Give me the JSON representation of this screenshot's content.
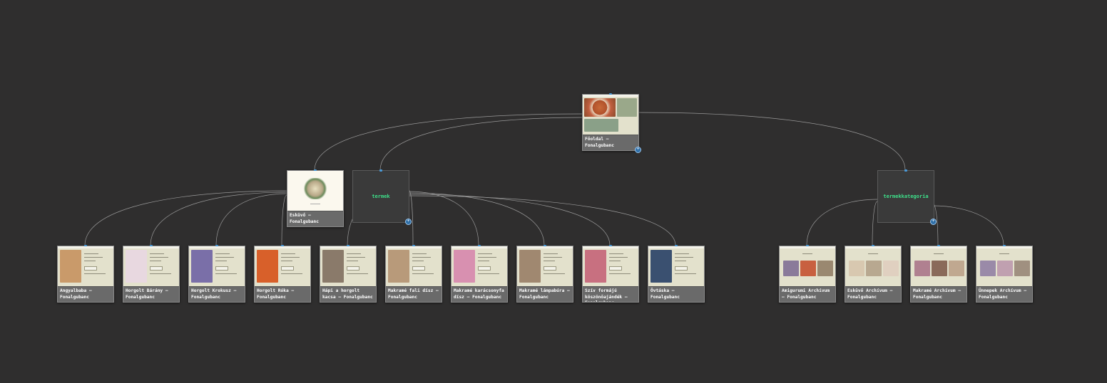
{
  "root": {
    "label": "Főoldal – Fonalgubanc"
  },
  "groups": {
    "eskuvo": {
      "label": "Esküvő – Fonalgubanc"
    },
    "termek": {
      "label": "termek"
    },
    "termekkategoria": {
      "label": "termekkategoria"
    }
  },
  "products": [
    {
      "label": "Angyalbaba – Fonalgubanc",
      "color": "#c99a6a"
    },
    {
      "label": "Horgolt Bárány – Fonalgubanc",
      "color": "#e8d8e0"
    },
    {
      "label": "Horgolt Krokusz – Fonalgubanc",
      "color": "#7a6fa8"
    },
    {
      "label": "Horgolt Róka – Fonalgubanc",
      "color": "#d8602a"
    },
    {
      "label": "Hápi a horgolt kacsa – Fonalgubanc",
      "color": "#8a7a6a"
    },
    {
      "label": "Makramé fali dísz – Fonalgubanc",
      "color": "#b89a7a"
    },
    {
      "label": "Makramé karácsonyfa dísz – Fonalgubanc",
      "color": "#d890b0"
    },
    {
      "label": "Makramé lámpabúra – Fonalgubanc",
      "color": "#a08870"
    },
    {
      "label": "Szív formájú köszönőajándék – Fonalgubanc",
      "color": "#c87080"
    },
    {
      "label": "Övtáska – Fonalgubanc",
      "color": "#3a5070"
    }
  ],
  "categories": [
    {
      "label": "Amigurumi Archívum – Fonalgubanc",
      "colors": [
        "#8a7a9a",
        "#c86040",
        "#9a8870"
      ]
    },
    {
      "label": "Esküvő Archívum – Fonalgubanc",
      "colors": [
        "#d8c8b0",
        "#b8a890",
        "#e0d0c0"
      ]
    },
    {
      "label": "Makramé Archívum – Fonalgubanc",
      "colors": [
        "#b08090",
        "#8a6a5a",
        "#c0a890"
      ]
    },
    {
      "label": "Ünnepek Archívum – Fonalgubanc",
      "colors": [
        "#9a8aa8",
        "#c0a0b0",
        "#a09080"
      ]
    }
  ]
}
